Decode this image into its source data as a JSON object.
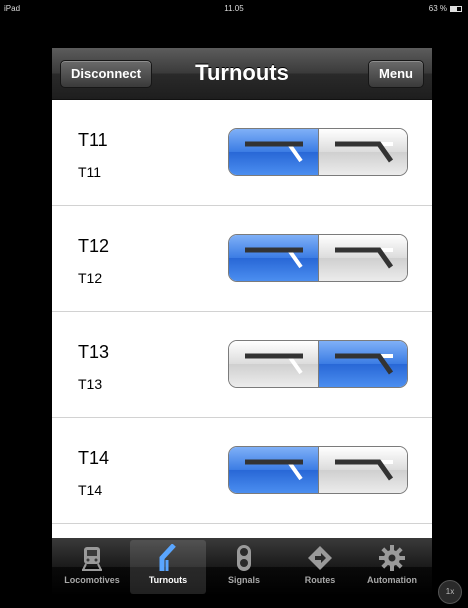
{
  "status_bar": {
    "carrier": "iPad",
    "time": "11.05",
    "battery": "63 %"
  },
  "navbar": {
    "title": "Turnouts",
    "left_button": "Disconnect",
    "right_button": "Menu"
  },
  "turnouts": [
    {
      "title": "T11",
      "subtitle": "T11",
      "selected": "straight"
    },
    {
      "title": "T12",
      "subtitle": "T12",
      "selected": "straight"
    },
    {
      "title": "T13",
      "subtitle": "T13",
      "selected": "diverging"
    },
    {
      "title": "T14",
      "subtitle": "T14",
      "selected": "straight"
    }
  ],
  "tabbar": {
    "items": [
      {
        "label": "Locomotives",
        "icon": "train-icon"
      },
      {
        "label": "Turnouts",
        "icon": "turnout-icon",
        "active": true
      },
      {
        "label": "Signals",
        "icon": "signal-icon"
      },
      {
        "label": "Routes",
        "icon": "route-icon"
      },
      {
        "label": "Automation",
        "icon": "gear-icon"
      }
    ]
  },
  "zoom_badge": "1x",
  "colors": {
    "accent_blue": "#3b7ce4",
    "navbar_dark": "#2a2a2a"
  }
}
